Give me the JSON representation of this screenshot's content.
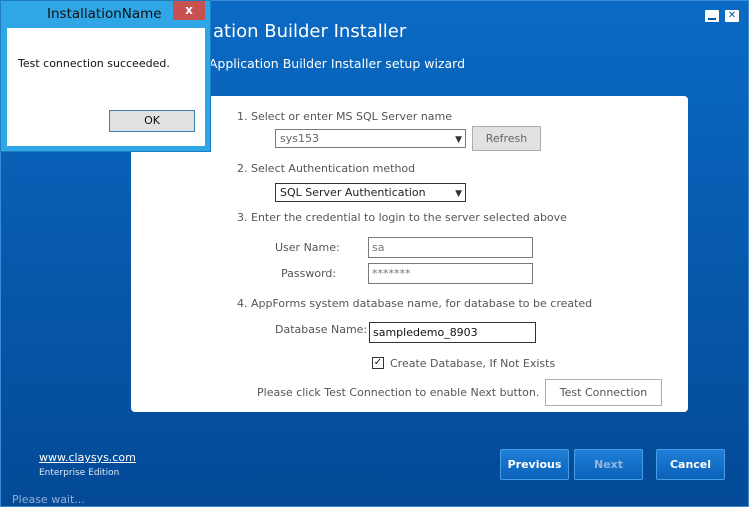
{
  "installer": {
    "title": "ation Builder Installer",
    "subtitle": "ys Application Builder Installer setup wizard",
    "minimize_icon": "minimize-icon",
    "close_icon": "close-icon"
  },
  "form": {
    "step1_label": "1. Select or enter MS SQL Server name",
    "server_value": "sys153",
    "refresh_label": "Refresh",
    "step2_label": "2. Select Authentication method",
    "auth_value": "SQL Server Authentication",
    "step3_label": "3. Enter the credential to login to the server selected above",
    "username_label": "User Name:",
    "username_value": "sa",
    "password_label": "Password:",
    "password_value": "*******",
    "step4_label": "4. AppForms system database name, for database to be created",
    "dbname_label": "Database Name:",
    "dbname_value": "sampledemo_8903",
    "create_db_label": "Create Database, If Not Exists",
    "create_db_checked": true,
    "test_hint": "Please click Test Connection to enable Next button.",
    "test_button_label": "Test Connection"
  },
  "footer": {
    "link_text": "www.claysys.com",
    "edition": "Enterprise Edition",
    "status": "Please wait...",
    "previous_label": "Previous",
    "next_label": "Next",
    "cancel_label": "Cancel"
  },
  "dialog": {
    "title": "InstallationName",
    "close_glyph": "x",
    "message": "Test connection succeeded.",
    "ok_label": "OK"
  }
}
